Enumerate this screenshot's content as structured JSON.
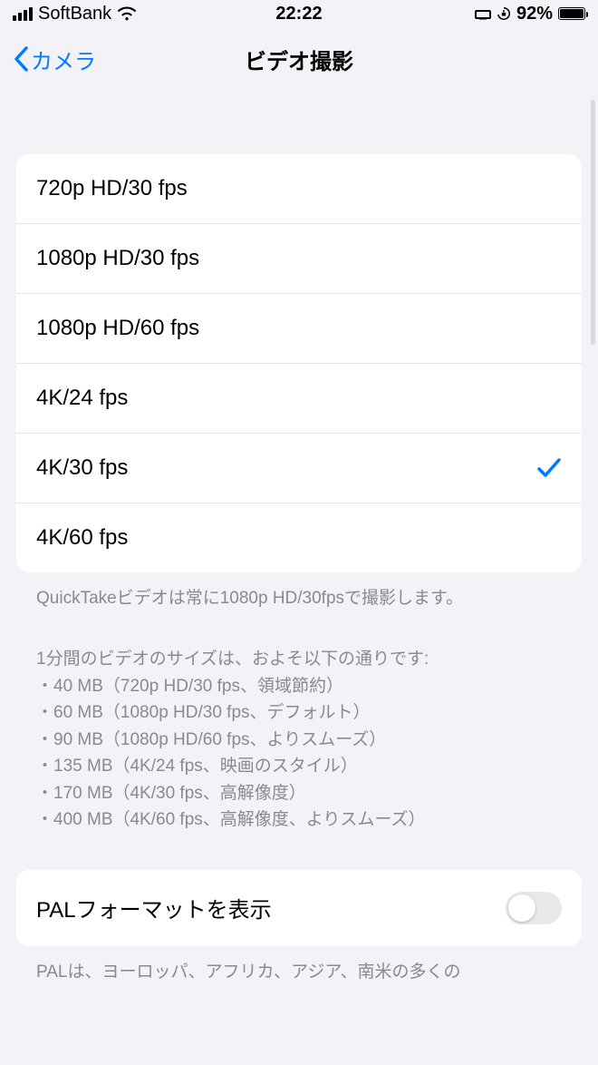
{
  "status": {
    "carrier": "SoftBank",
    "time": "22:22",
    "battery_pct": "92%",
    "battery_level": 0.92
  },
  "nav": {
    "back_label": "カメラ",
    "title": "ビデオ撮影"
  },
  "options": [
    {
      "label": "720p HD/30 fps",
      "selected": false
    },
    {
      "label": "1080p HD/30 fps",
      "selected": false
    },
    {
      "label": "1080p HD/60 fps",
      "selected": false
    },
    {
      "label": "4K/24 fps",
      "selected": false
    },
    {
      "label": "4K/30 fps",
      "selected": true
    },
    {
      "label": "4K/60 fps",
      "selected": false
    }
  ],
  "footer": {
    "quicktake": "QuickTakeビデオは常に1080p HD/30fpsで撮影します。",
    "size_intro": "1分間のビデオのサイズは、およそ以下の通りです:",
    "sizes": [
      "40 MB（720p HD/30 fps、領域節約）",
      "60 MB（1080p HD/30 fps、デフォルト）",
      "90 MB（1080p HD/60 fps、よりスムーズ）",
      "135 MB（4K/24 fps、映画のスタイル）",
      "170 MB（4K/30 fps、高解像度）",
      "400 MB（4K/60 fps、高解像度、よりスムーズ）"
    ]
  },
  "pal": {
    "label": "PALフォーマットを表示",
    "enabled": false,
    "cutoff_text": "PALは、ヨーロッパ、アフリカ、アジア、南米の多くの"
  }
}
